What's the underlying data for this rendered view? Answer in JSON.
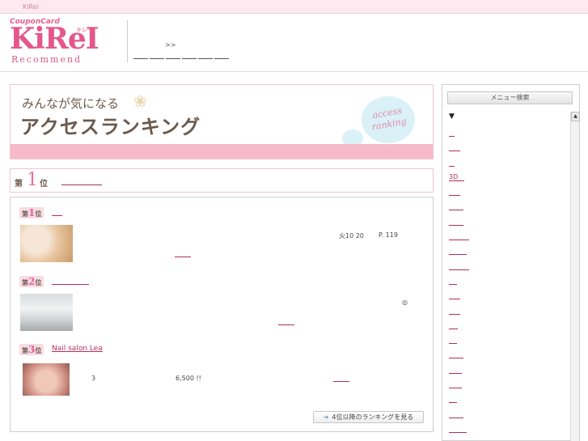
{
  "topbar": {
    "site_label": "KiReI"
  },
  "logo": {
    "coupon": "CouponCard",
    "kirei": "KiReI",
    "kana": "キレイ",
    "sub": "Recommend"
  },
  "breadcrumb": {
    "separator": ">>"
  },
  "banner": {
    "line1": "みんなが気になる",
    "line2": "アクセスランキング",
    "cloud_line1": "access",
    "cloud_line2": "ranking"
  },
  "rank_header": {
    "dai": "第",
    "num": "1",
    "i": "位"
  },
  "rankings": [
    {
      "badge_prefix": "第",
      "badge_num": "1",
      "badge_suffix": "位",
      "name": "",
      "info_a": "火10 20",
      "info_b": "P. 119"
    },
    {
      "badge_prefix": "第",
      "badge_num": "2",
      "badge_suffix": "位",
      "name": "",
      "info_a": "◎"
    },
    {
      "badge_prefix": "第",
      "badge_num": "3",
      "badge_suffix": "位",
      "name": "Nail salon Lea",
      "info_a": "3",
      "info_b": "6,500 !!"
    }
  ],
  "more_button": {
    "label": "4位以降のランキングを見る",
    "arrow": "➔"
  },
  "sidebar": {
    "button": "メニュー検索",
    "toggle": "▼",
    "items": [
      "",
      "",
      "",
      "3D",
      "",
      "",
      "",
      "",
      "",
      "",
      "",
      "",
      "",
      "",
      "",
      "",
      "",
      "",
      "",
      "",
      "",
      ""
    ],
    "scroll_up": "▲"
  }
}
